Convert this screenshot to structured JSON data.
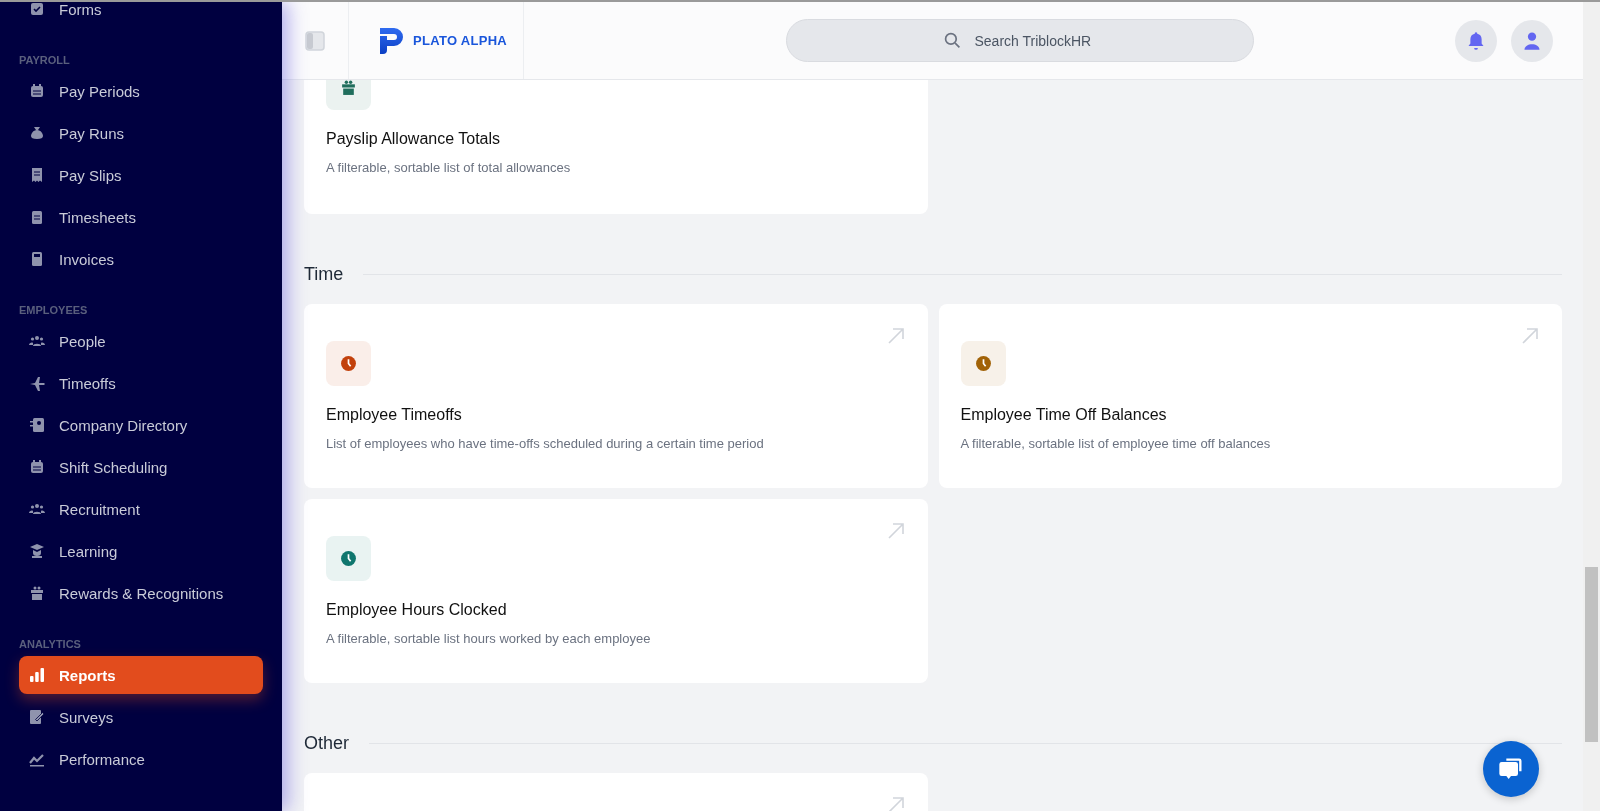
{
  "sidebar": {
    "sections": [
      {
        "items": [
          {
            "label": "Forms",
            "selected": false
          }
        ]
      },
      {
        "title": "PAYROLL",
        "items": [
          {
            "label": "Pay Periods",
            "selected": false
          },
          {
            "label": "Pay Runs",
            "selected": false
          },
          {
            "label": "Pay Slips",
            "selected": false
          },
          {
            "label": "Timesheets",
            "selected": false
          },
          {
            "label": "Invoices",
            "selected": false
          }
        ]
      },
      {
        "title": "EMPLOYEES",
        "items": [
          {
            "label": "People",
            "selected": false
          },
          {
            "label": "Timeoffs",
            "selected": false
          },
          {
            "label": "Company Directory",
            "selected": false
          },
          {
            "label": "Shift Scheduling",
            "selected": false
          },
          {
            "label": "Recruitment",
            "selected": false
          },
          {
            "label": "Learning",
            "selected": false
          },
          {
            "label": "Rewards & Recognitions",
            "selected": false
          }
        ]
      },
      {
        "title": "ANALYTICS",
        "items": [
          {
            "label": "Reports",
            "selected": true
          },
          {
            "label": "Surveys",
            "selected": false
          },
          {
            "label": "Performance",
            "selected": false
          }
        ]
      }
    ]
  },
  "header": {
    "logo": "PLATO ALPHA",
    "search": {
      "placeholder": "Search TriblockHR"
    }
  },
  "top_card": {
    "title": "Payslip Allowance Totals",
    "description": "A filterable, sortable list of total allowances",
    "color": "#1f6e5c"
  },
  "sections": [
    {
      "title": "Time",
      "cards": [
        {
          "kind": "report",
          "title": "Employee Timeoffs",
          "description": "List of employees who have time-offs scheduled during a certain time period",
          "color": "#c2410c"
        },
        {
          "kind": "report",
          "title": "Employee Time Off Balances",
          "description": "A filterable, sortable list of employee time off balances",
          "color": "#a16207"
        },
        {
          "kind": "report",
          "title": "Employee Hours Clocked",
          "description": "A filterable, sortable list hours worked by each employee",
          "color": "#0f766e"
        }
      ]
    },
    {
      "title": "Other",
      "cards": [
        {
          "kind": "cut"
        }
      ]
    }
  ]
}
